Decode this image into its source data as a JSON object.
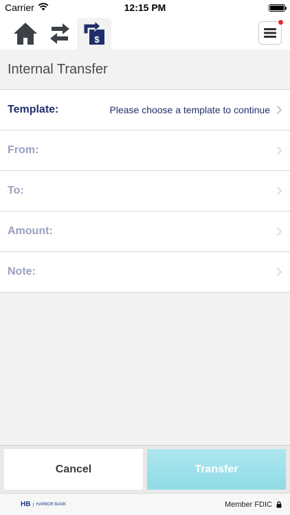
{
  "status_bar": {
    "carrier": "Carrier",
    "time": "12:15 PM"
  },
  "nav": {
    "tabs": [
      {
        "icon": "home-icon"
      },
      {
        "icon": "transfer-arrows-icon"
      },
      {
        "icon": "internal-transfer-icon",
        "active": true
      }
    ],
    "menu_icon": "hamburger-menu-icon",
    "notification_color": "#e52b2b"
  },
  "page": {
    "title": "Internal Transfer"
  },
  "form": {
    "template": {
      "label": "Template:",
      "value": "Please choose a template to continue"
    },
    "from": {
      "label": "From:",
      "value": ""
    },
    "to": {
      "label": "To:",
      "value": ""
    },
    "amount": {
      "label": "Amount:",
      "value": ""
    },
    "note": {
      "label": "Note:",
      "value": ""
    }
  },
  "buttons": {
    "cancel": "Cancel",
    "transfer": "Transfer"
  },
  "footer": {
    "logo_initials": "HB",
    "logo_name": "HARBOR BANK",
    "member_fdic": "Member FDIC"
  },
  "colors": {
    "primary": "#1f2f6b",
    "muted_label": "#9aa0bf",
    "transfer_button": "#8fdbe6"
  }
}
